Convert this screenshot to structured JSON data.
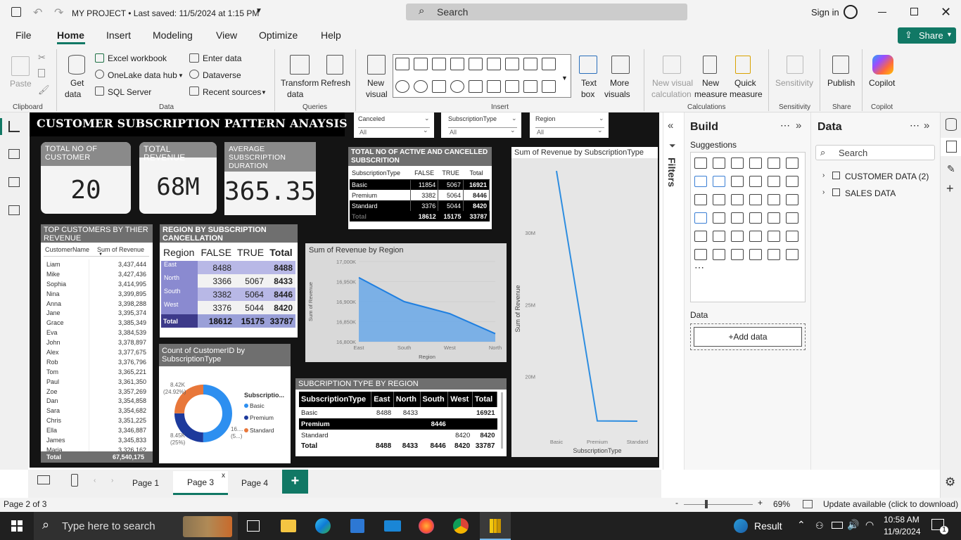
{
  "window": {
    "title": "MY PROJECT • Last saved: 11/5/2024 at 1:15 PM",
    "search_placeholder": "Search",
    "signin": "Sign in"
  },
  "menu": {
    "items": [
      "File",
      "Home",
      "Insert",
      "Modeling",
      "View",
      "Optimize",
      "Help"
    ],
    "share": "Share"
  },
  "ribbon": {
    "paste": "Paste",
    "get_data": "Get",
    "get_data2": "data",
    "excel": "Excel workbook",
    "onelake": "OneLake data hub",
    "sql": "SQL Server",
    "enter_data": "Enter data",
    "dataverse": "Dataverse",
    "recent": "Recent sources",
    "transform": "Transform",
    "transform2": "data",
    "refresh": "Refresh",
    "new_visual": "New",
    "new_visual2": "visual",
    "text_box": "Text",
    "text_box2": "box",
    "more_visuals": "More",
    "more_visuals2": "visuals",
    "new_visual_calc": "New visual",
    "new_visual_calc2": "calculation",
    "new_measure": "New",
    "new_measure2": "measure",
    "quick_measure": "Quick",
    "quick_measure2": "measure",
    "sensitivity": "Sensitivity",
    "publish": "Publish",
    "copilot": "Copilot",
    "groups": {
      "clipboard": "Clipboard",
      "data": "Data",
      "queries": "Queries",
      "insert": "Insert",
      "calculations": "Calculations",
      "sensitivity": "Sensitivity",
      "share": "Share",
      "copilot": "Copilot"
    }
  },
  "report": {
    "title": "CUSTOMER SUBSCRIPTION PATTERN ANAYSIS",
    "slicers": [
      {
        "label": "Canceled",
        "value": "All"
      },
      {
        "label": "SubscriptionType",
        "value": "All"
      },
      {
        "label": "Region",
        "value": "All"
      }
    ],
    "cards": [
      {
        "label": "TOTAL NO OF CUSTOMER",
        "value": "20"
      },
      {
        "label": "TOTAL REVENUE",
        "value": "68M"
      },
      {
        "label": "AVERAGE SUBSCRIPTION DURATION",
        "value": "365.35"
      }
    ],
    "top_customers": {
      "title": "TOP CUSTOMERS BY THIER REVENUE",
      "col1": "CustomerName",
      "col2": "Sum of Revenue",
      "rows": [
        [
          "Liam",
          "3,437,444"
        ],
        [
          "Mike",
          "3,427,436"
        ],
        [
          "Sophia",
          "3,414,995"
        ],
        [
          "Nina",
          "3,399,895"
        ],
        [
          "Anna",
          "3,398,288"
        ],
        [
          "Jane",
          "3,395,374"
        ],
        [
          "Grace",
          "3,385,349"
        ],
        [
          "Eva",
          "3,384,539"
        ],
        [
          "John",
          "3,378,897"
        ],
        [
          "Alex",
          "3,377,675"
        ],
        [
          "Rob",
          "3,376,796"
        ],
        [
          "Tom",
          "3,365,221"
        ],
        [
          "Paul",
          "3,361,350"
        ],
        [
          "Zoe",
          "3,357,269"
        ],
        [
          "Dan",
          "3,354,858"
        ],
        [
          "Sara",
          "3,354,682"
        ],
        [
          "Chris",
          "3,351,225"
        ],
        [
          "Ella",
          "3,346,887"
        ],
        [
          "James",
          "3,345,833"
        ],
        [
          "Maria",
          "3,326,162"
        ]
      ],
      "total_label": "Total",
      "total_value": "67,540,175"
    },
    "region_cancel": {
      "title": "REGION BY SUBSCRIPTION CANCELLATION",
      "headers": [
        "Region",
        "FALSE",
        "TRUE",
        "Total"
      ],
      "rows": [
        [
          "East",
          "8488",
          "",
          "8488"
        ],
        [
          "North",
          "3366",
          "5067",
          "8433"
        ],
        [
          "South",
          "3382",
          "5064",
          "8446"
        ],
        [
          "West",
          "3376",
          "5044",
          "8420"
        ]
      ],
      "total": [
        "Total",
        "18612",
        "15175",
        "33787"
      ]
    },
    "active_cancel": {
      "title": "TOTAL NO OF ACTIVE AND CANCELLED SUBSCRITION",
      "headers": [
        "SubscriptionType",
        "FALSE",
        "TRUE",
        "Total"
      ],
      "rows": [
        [
          "Basic",
          "11854",
          "5067",
          "16921"
        ],
        [
          "Premium",
          "3382",
          "5064",
          "8446"
        ],
        [
          "Standard",
          "3376",
          "5044",
          "8420"
        ]
      ],
      "total": [
        "Total",
        "18612",
        "15175",
        "33787"
      ]
    },
    "type_region": {
      "title": "SUBCRIPTION TYPE BY REGION",
      "headers": [
        "SubscriptionType",
        "East",
        "North",
        "South",
        "West",
        "Total"
      ],
      "rows": [
        [
          "Basic",
          "8488",
          "8433",
          "",
          "",
          "16921"
        ],
        [
          "Premium",
          "",
          "",
          "8446",
          "",
          ""
        ],
        [
          "Standard",
          "",
          "",
          "",
          "8420",
          "8420"
        ]
      ],
      "total": [
        "Total",
        "8488",
        "8433",
        "8446",
        "8420",
        "33787"
      ]
    },
    "donut": {
      "title": "Count of CustomerID by SubscriptionType",
      "legend_title": "Subscriptio...",
      "lbl_top": "8.42K",
      "lbl_top2": "(24.92%)",
      "lbl_bottom": "8.45K",
      "lbl_bottom2": "(25%)",
      "lbl_right": "16....",
      "lbl_right2": "(5...)"
    }
  },
  "chart_data": [
    {
      "type": "area",
      "title": "Sum of Revenue by Region",
      "xlabel": "Region",
      "ylabel": "Sum of Revenue",
      "categories": [
        "East",
        "South",
        "West",
        "North"
      ],
      "values": [
        16960000,
        16900000,
        16870000,
        16820000
      ],
      "ylim": [
        16800000,
        17000000
      ],
      "ytick_labels": [
        "17,000K",
        "16,950K",
        "16,900K",
        "16,850K",
        "16,800K"
      ],
      "color": "#5b9bd5"
    },
    {
      "type": "line",
      "title": "Sum of Revenue by SubscriptionType",
      "xlabel": "SubscriptionType",
      "ylabel": "Sum of Revenue",
      "categories": [
        "Basic",
        "Premium",
        "Standard"
      ],
      "values": [
        34300000,
        16920000,
        16900000
      ],
      "ylim": [
        17000000,
        34500000
      ],
      "ytick_labels": [
        "30M",
        "25M",
        "20M"
      ],
      "color": "#2e8de0"
    },
    {
      "type": "pie",
      "title": "Count of CustomerID by SubscriptionType",
      "categories": [
        "Basic",
        "Premium",
        "Standard"
      ],
      "values": [
        16920,
        8450,
        8420
      ],
      "colors": [
        "#2d8ff0",
        "#1d3a9c",
        "#e8773a"
      ]
    }
  ],
  "panes": {
    "filters": "Filters",
    "build": "Build",
    "suggestions": "Suggestions",
    "data": "Data",
    "data_label": "Data",
    "add_data": "+Add data",
    "search": "Search",
    "tables": [
      "CUSTOMER DATA (2)",
      "SALES DATA"
    ]
  },
  "tabs": {
    "pages": [
      "Page 1",
      "Page 3",
      "Page 4"
    ]
  },
  "status": {
    "page": "Page 2 of 3",
    "zoom": "69%",
    "update": "Update available (click to download)"
  },
  "taskbar": {
    "search": "Type here to search",
    "result": "Result",
    "time": "10:58 AM",
    "date": "11/9/2024",
    "notif": "1"
  }
}
